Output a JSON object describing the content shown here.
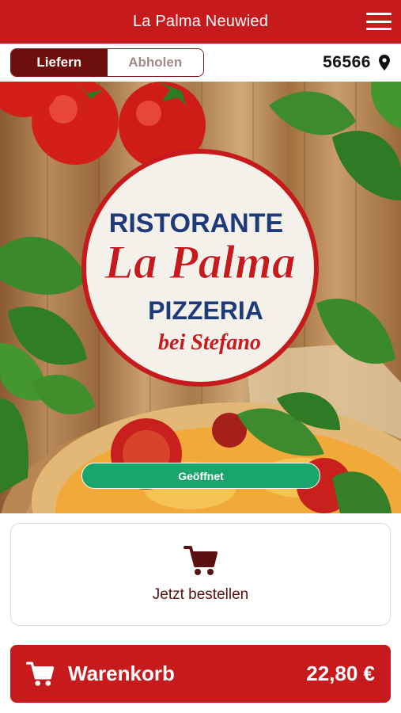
{
  "header": {
    "title": "La Palma Neuwied",
    "menu_icon": "hamburger-menu-icon"
  },
  "mode": {
    "options": [
      {
        "label": "Liefern",
        "active": true
      },
      {
        "label": "Abholen",
        "active": false
      }
    ]
  },
  "location": {
    "zip": "56566",
    "icon": "map-marker-icon"
  },
  "hero": {
    "logo_line1": "RISTORANTE",
    "logo_line2": "La Palma",
    "logo_line3": "PIZZERIA",
    "logo_line4": "bei Stefano",
    "status": "Geöffnet"
  },
  "order": {
    "label": "Jetzt bestellen",
    "icon": "shopping-cart-icon"
  },
  "cart": {
    "label": "Warenkorb",
    "total": "22,80 €",
    "icon": "shopping-cart-icon"
  },
  "colors": {
    "brand_red": "#c61a1d",
    "dark_red": "#6e0f0e",
    "status_green": "#1aa56c"
  }
}
